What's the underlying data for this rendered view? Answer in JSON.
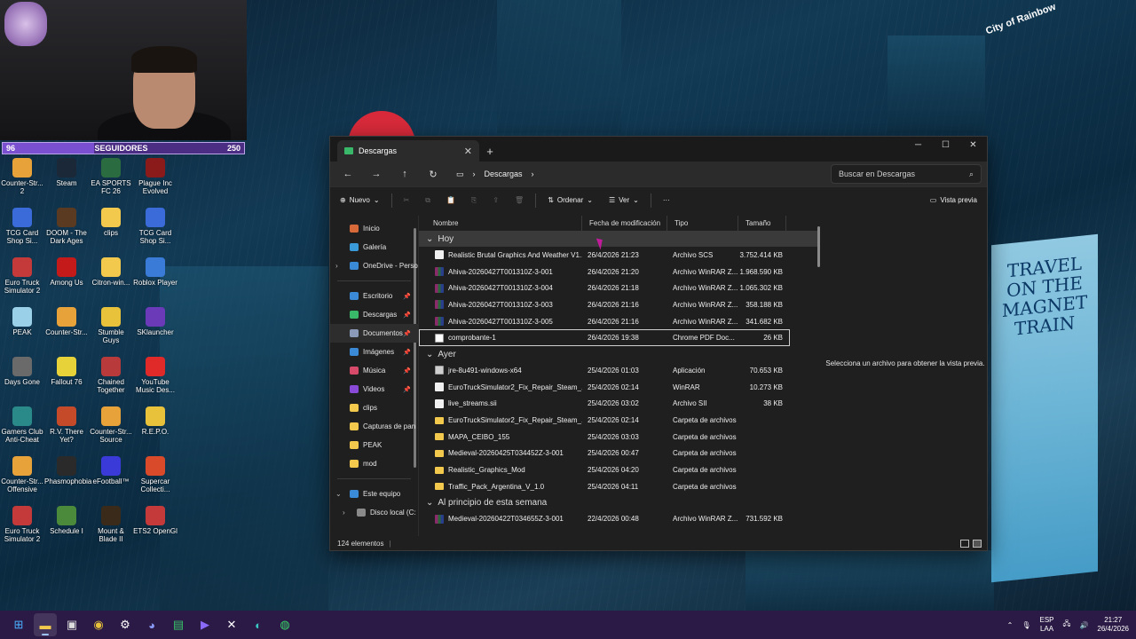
{
  "webcam": {
    "follow_left": "96",
    "follow_label": "SEGUIDORES",
    "follow_right": "250"
  },
  "desktop_icons": [
    {
      "label": "Counter-Str... 2",
      "color": "#e8a23a"
    },
    {
      "label": "Steam",
      "color": "#1b2838"
    },
    {
      "label": "EA SPORTS FC 26",
      "color": "#2a6b3f"
    },
    {
      "label": "Plague Inc Evolved",
      "color": "#8b1a1a"
    },
    {
      "label": "TCG Card Shop Si...",
      "color": "#3a6bd8"
    },
    {
      "label": "DOOM - The Dark Ages",
      "color": "#5a3a20"
    },
    {
      "label": "clips",
      "color": "#f2c94c"
    },
    {
      "label": "TCG Card Shop Si...",
      "color": "#3a6bd8"
    },
    {
      "label": "Euro Truck Simulator 2",
      "color": "#c43a3a"
    },
    {
      "label": "Among Us",
      "color": "#c41a1a"
    },
    {
      "label": "Citron-win...",
      "color": "#f2c94c"
    },
    {
      "label": "Roblox Player",
      "color": "#3a7bd8"
    },
    {
      "label": "PEAK",
      "color": "#9ad0e8"
    },
    {
      "label": "Counter-Str...",
      "color": "#e8a23a"
    },
    {
      "label": "Stumble Guys",
      "color": "#e8c23a"
    },
    {
      "label": "SKlauncher",
      "color": "#6a3ab8"
    },
    {
      "label": "Days Gone",
      "color": "#6a6a6a"
    },
    {
      "label": "Fallout 76",
      "color": "#e8d23a"
    },
    {
      "label": "Chained Together",
      "color": "#b83a3a"
    },
    {
      "label": "YouTube Music Des...",
      "color": "#e02a2a"
    },
    {
      "label": "Gamers Club Anti-Cheat",
      "color": "#2a8a8a"
    },
    {
      "label": "R.V. There Yet?",
      "color": "#c44a2a"
    },
    {
      "label": "Counter-Str... Source",
      "color": "#e8a23a"
    },
    {
      "label": "R.E.P.O.",
      "color": "#e8c23a"
    },
    {
      "label": "Counter-Str... Offensive",
      "color": "#e8a23a"
    },
    {
      "label": "Phasmophobia",
      "color": "#2a2a2a"
    },
    {
      "label": "eFootball™",
      "color": "#3a3ad8"
    },
    {
      "label": "Supercar Collecti...",
      "color": "#d84a2a"
    },
    {
      "label": "Euro Truck Simulator 2",
      "color": "#c43a3a"
    },
    {
      "label": "Schedule I",
      "color": "#4a8a3a"
    },
    {
      "label": "Mount & Blade II",
      "color": "#3a2a1a"
    },
    {
      "label": "ETS2 OpenGl",
      "color": "#c43a3a"
    }
  ],
  "explorer": {
    "tab_title": "Descargas",
    "breadcrumb": "Descargas",
    "search_placeholder": "Buscar en Descargas",
    "toolbar": {
      "new": "Nuevo",
      "sort": "Ordenar",
      "view": "Ver",
      "more": "···",
      "preview": "Vista previa"
    },
    "nav": [
      {
        "label": "Inicio",
        "color": "#d86a3a",
        "pin": ""
      },
      {
        "label": "Galería",
        "color": "#3a9ad8",
        "pin": ""
      },
      {
        "label": "OneDrive - Perso",
        "color": "#3a8ad8",
        "pin": "",
        "exp": "›"
      },
      {
        "sep": true
      },
      {
        "label": "Escritorio",
        "color": "#3a8ad8",
        "pin": "📌"
      },
      {
        "label": "Descargas",
        "color": "#3ab86a",
        "pin": "📌"
      },
      {
        "label": "Documentos",
        "color": "#8a9ab8",
        "pin": "📌",
        "sel": true
      },
      {
        "label": "Imágenes",
        "color": "#3a8ad8",
        "pin": "📌"
      },
      {
        "label": "Música",
        "color": "#d84a6a",
        "pin": "📌"
      },
      {
        "label": "Videos",
        "color": "#8a4ad8",
        "pin": "📌"
      },
      {
        "label": "clips",
        "color": "#f2c94c",
        "pin": ""
      },
      {
        "label": "Capturas de pan",
        "color": "#f2c94c",
        "pin": ""
      },
      {
        "label": "PEAK",
        "color": "#f2c94c",
        "pin": ""
      },
      {
        "label": "mod",
        "color": "#f2c94c",
        "pin": ""
      },
      {
        "sep": true
      },
      {
        "label": "Este equipo",
        "color": "#3a8ad8",
        "pin": "",
        "exp": "⌄"
      },
      {
        "label": "Disco local (C:",
        "color": "#8a8a8a",
        "pin": "",
        "exp": "›",
        "indent": true
      }
    ],
    "columns": {
      "name": "Nombre",
      "date": "Fecha de modificación",
      "type": "Tipo",
      "size": "Tamaño"
    },
    "groups": [
      {
        "title": "Hoy",
        "rows": [
          {
            "name": "Realistic Brutal Graphics And Weather V1...",
            "date": "26/4/2026 21:23",
            "type": "Archivo SCS",
            "size": "3.752.414 KB",
            "icon": "doc"
          },
          {
            "name": "Ahiva-20260427T001310Z-3-001",
            "date": "26/4/2026 21:20",
            "type": "Archivo WinRAR Z...",
            "size": "1.968.590 KB",
            "icon": "rar"
          },
          {
            "name": "Ahiva-20260427T001310Z-3-004",
            "date": "26/4/2026 21:18",
            "type": "Archivo WinRAR Z...",
            "size": "1.065.302 KB",
            "icon": "rar"
          },
          {
            "name": "Ahiva-20260427T001310Z-3-003",
            "date": "26/4/2026 21:16",
            "type": "Archivo WinRAR Z...",
            "size": "358.188 KB",
            "icon": "rar"
          },
          {
            "name": "Ahiva-20260427T001310Z-3-005",
            "date": "26/4/2026 21:16",
            "type": "Archivo WinRAR Z...",
            "size": "341.682 KB",
            "icon": "rar"
          },
          {
            "name": "comprobante-1",
            "date": "26/4/2026 19:38",
            "type": "Chrome PDF Doc...",
            "size": "26 KB",
            "icon": "pdf",
            "focus": true
          }
        ]
      },
      {
        "title": "Ayer",
        "rows": [
          {
            "name": "jre-8u491-windows-x64",
            "date": "25/4/2026 01:03",
            "type": "Aplicación",
            "size": "70.653 KB",
            "icon": "exe"
          },
          {
            "name": "EuroTruckSimulator2_Fix_Repair_Steam_...",
            "date": "25/4/2026 02:14",
            "type": "WinRAR",
            "size": "10.273 KB",
            "icon": "doc"
          },
          {
            "name": "live_streams.sii",
            "date": "25/4/2026 03:02",
            "type": "Archivo SII",
            "size": "38 KB",
            "icon": "doc"
          },
          {
            "name": "EuroTruckSimulator2_Fix_Repair_Steam_...",
            "date": "25/4/2026 02:14",
            "type": "Carpeta de archivos",
            "size": "",
            "icon": "folder"
          },
          {
            "name": "MAPA_CEIBO_155",
            "date": "25/4/2026 03:03",
            "type": "Carpeta de archivos",
            "size": "",
            "icon": "folder"
          },
          {
            "name": "Medieval-20260425T034452Z-3-001",
            "date": "25/4/2026 00:47",
            "type": "Carpeta de archivos",
            "size": "",
            "icon": "folder"
          },
          {
            "name": "Realistic_Graphics_Mod",
            "date": "25/4/2026 04:20",
            "type": "Carpeta de archivos",
            "size": "",
            "icon": "folder"
          },
          {
            "name": "Traffic_Pack_Argentina_V_1.0",
            "date": "25/4/2026 04:11",
            "type": "Carpeta de archivos",
            "size": "",
            "icon": "folder"
          }
        ]
      },
      {
        "title": "Al principio de esta semana",
        "rows": [
          {
            "name": "Medieval-20260422T034655Z-3-001",
            "date": "22/4/2026 00:48",
            "type": "Archivo WinRAR Z...",
            "size": "731.592 KB",
            "icon": "rar"
          }
        ]
      }
    ],
    "preview_text": "Selecciona un archivo para obtener la vista previa.",
    "status": "124 elementos"
  },
  "taskbar": {
    "lang1": "ESP",
    "lang2": "LAA",
    "time": "21:27",
    "date": "26/4/2026"
  },
  "wallpaper": {
    "billboard": "TRAVEL ON THE MAGNET TRAIN",
    "city": "City of Rainbow"
  }
}
